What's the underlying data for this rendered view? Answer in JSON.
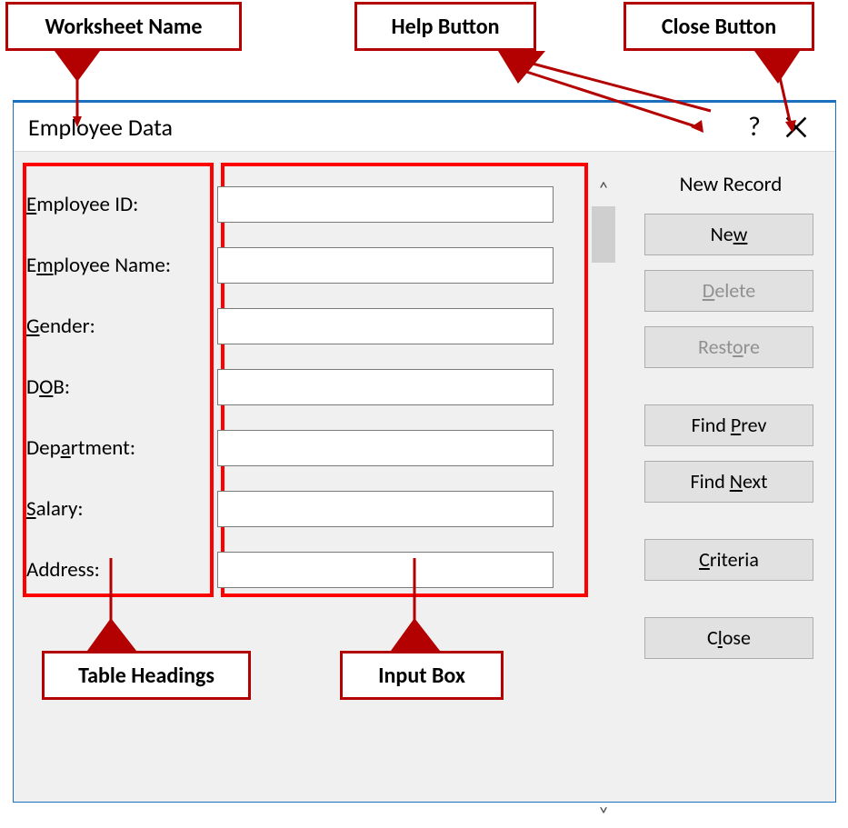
{
  "annotations": {
    "worksheet_name": "Worksheet Name",
    "help_button": "Help Button",
    "close_button": "Close Button",
    "table_headings": "Table Headings",
    "input_box": "Input Box"
  },
  "dialog": {
    "title": "Employee Data",
    "status": "New Record",
    "fields": {
      "employee_id": {
        "label_pre": "",
        "label_u": "E",
        "label_post": "mployee ID:",
        "value": ""
      },
      "employee_name": {
        "label_pre": "E",
        "label_u": "m",
        "label_post": "ployee Name:",
        "value": ""
      },
      "gender": {
        "label_pre": "",
        "label_u": "G",
        "label_post": "ender:",
        "value": ""
      },
      "dob": {
        "label_pre": "D",
        "label_u": "O",
        "label_post": "B:",
        "value": ""
      },
      "department": {
        "label_pre": "Dep",
        "label_u": "a",
        "label_post": "rtment:",
        "value": ""
      },
      "salary": {
        "label_pre": "",
        "label_u": "S",
        "label_post": "alary:",
        "value": ""
      },
      "address": {
        "label_pre": "A",
        "label_u": "",
        "label_post": "ddress:",
        "value": ""
      }
    },
    "buttons": {
      "new": {
        "pre": "Ne",
        "u": "w",
        "post": ""
      },
      "delete": {
        "pre": "",
        "u": "D",
        "post": "elete"
      },
      "restore": {
        "pre": "Rest",
        "u": "o",
        "post": "re"
      },
      "find_prev": {
        "pre": "Find ",
        "u": "P",
        "post": "rev"
      },
      "find_next": {
        "pre": "Find ",
        "u": "N",
        "post": "ext"
      },
      "criteria": {
        "pre": "",
        "u": "C",
        "post": "riteria"
      },
      "close": {
        "pre": "C",
        "u": "l",
        "post": "ose"
      }
    }
  }
}
